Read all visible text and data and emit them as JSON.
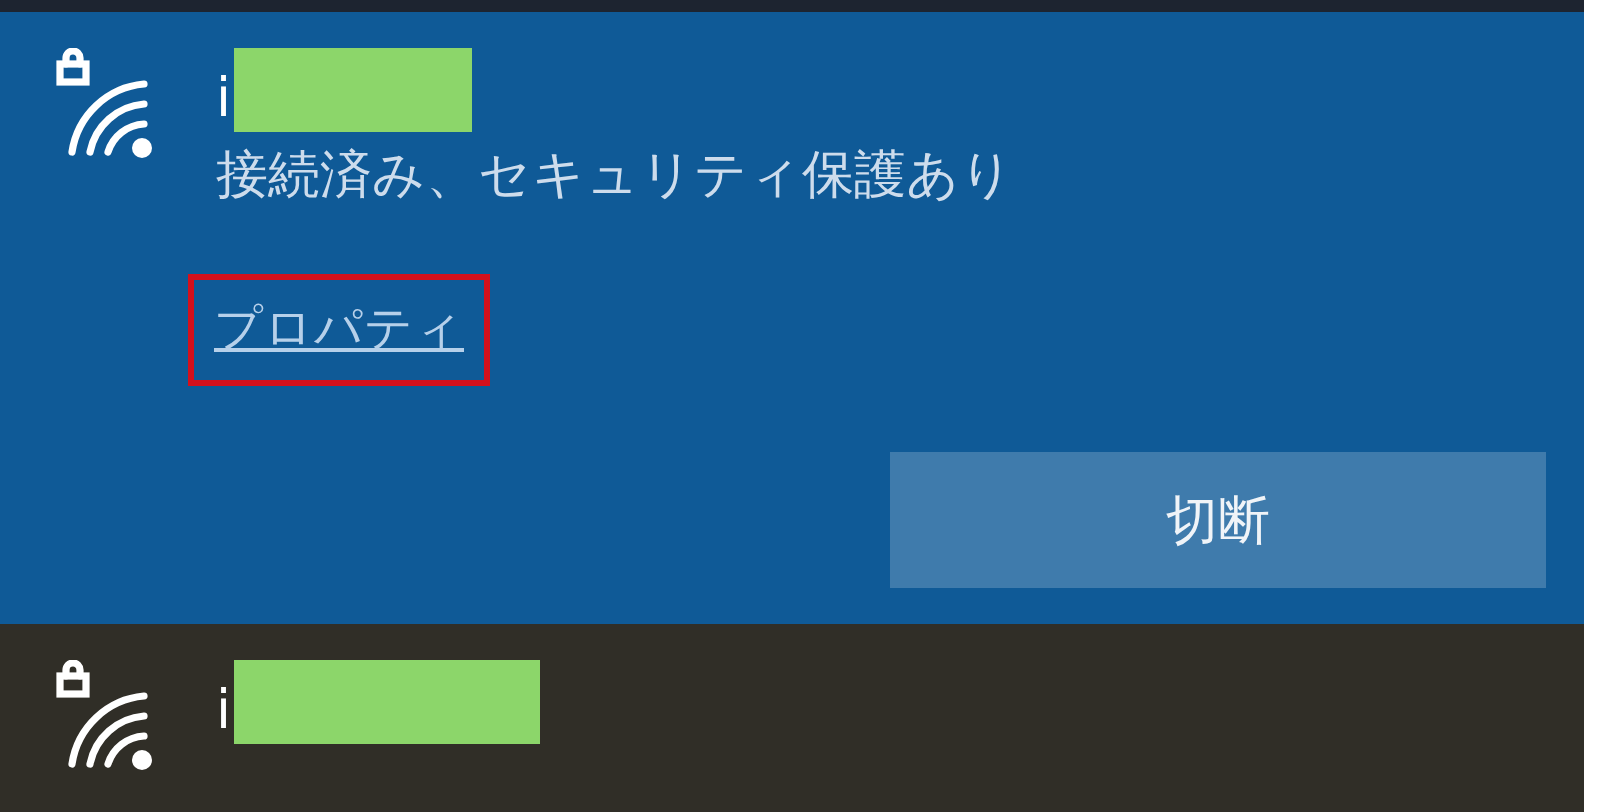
{
  "networks": [
    {
      "name": "i",
      "selected": true,
      "status": "接続済み、セキュリティ保護あり",
      "link": "プロパティ",
      "button": "切断"
    },
    {
      "name": "i",
      "selected": false
    }
  ]
}
